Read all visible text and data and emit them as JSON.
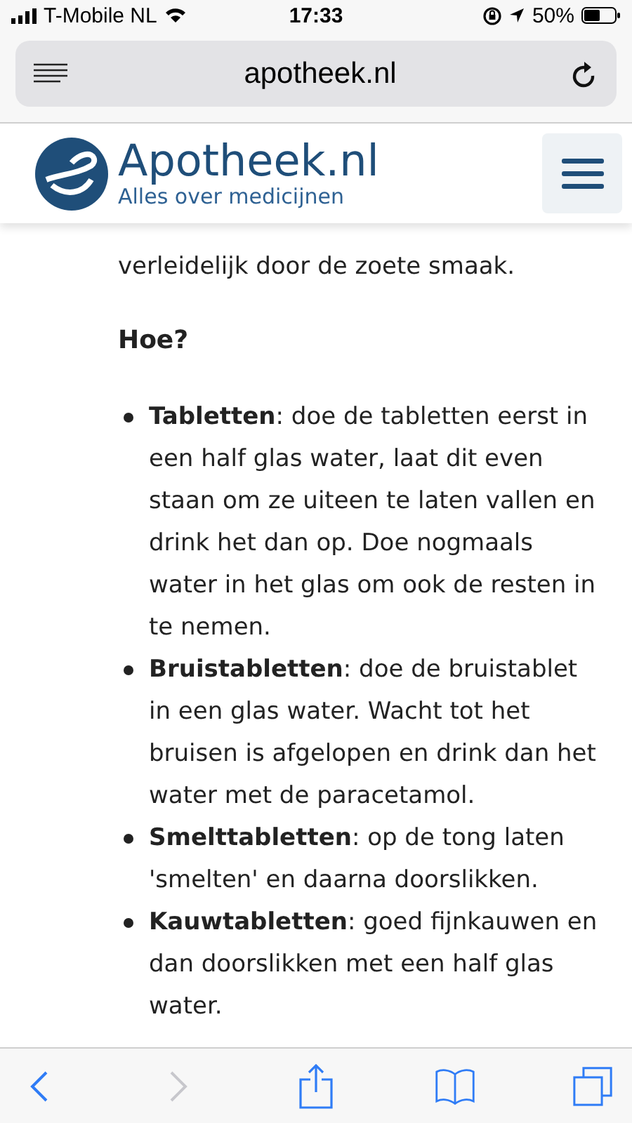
{
  "status_bar": {
    "carrier": "T-Mobile NL",
    "time": "17:33",
    "battery": "50%"
  },
  "address_bar": {
    "url": "apotheek.nl"
  },
  "site_header": {
    "title": "Apotheek.nl",
    "tagline": "Alles over medicijnen"
  },
  "article": {
    "paragraph": "verleidelijk door de zoete smaak.",
    "heading": "Hoe?",
    "items": [
      {
        "text": "**Tabletten**: doe de tabletten eerst in een half glas water, laat dit even staan om ze uiteen te laten vallen en drink het dan op. Doe nogmaals water in het glas om ook de resten in te nemen."
      },
      {
        "text": "**Bruistabletten**: doe de bruistablet in een glas water. Wacht tot het bruisen is afgelopen en drink dan het water met de paracetamol."
      },
      {
        "text": "**Smelttabletten**: op de tong laten 'smelten' en daarna doorslikken."
      },
      {
        "text": "**Kauwtabletten**: goed fijnkauwen en dan doorslikken met een half glas water."
      }
    ]
  },
  "toolbar": {
    "buttons": [
      {
        "kind": "back",
        "disabled": false
      },
      {
        "kind": "forward",
        "disabled": true
      },
      {
        "kind": "share",
        "disabled": false
      },
      {
        "kind": "bookmarks",
        "disabled": false
      },
      {
        "kind": "tabs",
        "disabled": false
      }
    ]
  }
}
